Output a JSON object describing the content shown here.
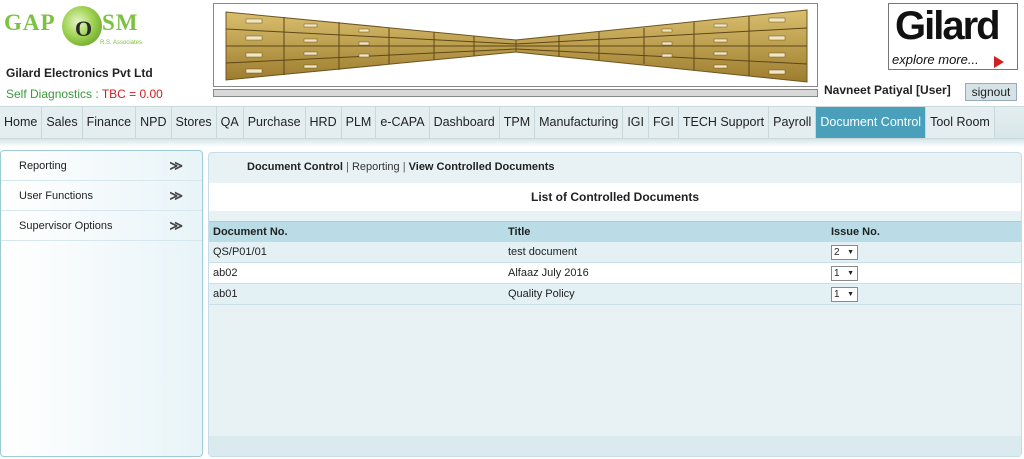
{
  "header": {
    "logo_left": "GAP",
    "logo_o": "O",
    "logo_right": "SM",
    "logo_tagline": "R.S. Associates",
    "company": "Gilard Electronics Pvt Ltd",
    "diag_label": "Self Diagnostics : ",
    "diag_value": "TBC = 0.00",
    "brand_main": "Gilard",
    "brand_sub": "explore more...",
    "user": "Navneet Patiyal [User]",
    "signout": "signout"
  },
  "nav": {
    "items": [
      "Home",
      "Sales",
      "Finance",
      "NPD",
      "Stores",
      "QA",
      "Purchase",
      "HRD",
      "PLM",
      "e-CAPA",
      "Dashboard",
      "TPM",
      "Manufacturing",
      "IGI",
      "FGI",
      "TECH Support",
      "Payroll",
      "Document Control",
      "Tool Room"
    ],
    "active": "Document Control"
  },
  "sidebar": {
    "items": [
      {
        "label": "Reporting",
        "arrow": "≫"
      },
      {
        "label": "User Functions",
        "arrow": "≫"
      },
      {
        "label": "Supervisor Options",
        "arrow": "≫"
      }
    ]
  },
  "breadcrumb": {
    "first": "Document Control",
    "second": "Reporting",
    "third": "View Controlled Documents",
    "sep": " | "
  },
  "list_title": "List of Controlled Documents",
  "table": {
    "headers": [
      "Document No.",
      "Title",
      "Issue No."
    ],
    "rows": [
      {
        "doc": "QS/P01/01",
        "title": "test document",
        "issue": "2"
      },
      {
        "doc": "ab02",
        "title": "Alfaaz July 2016",
        "issue": "1"
      },
      {
        "doc": "ab01",
        "title": "Quality Policy",
        "issue": "1"
      }
    ]
  },
  "colors": {
    "accent": "#4aa0bb",
    "brand_green": "#7cc242",
    "alert_red": "#d02020"
  }
}
